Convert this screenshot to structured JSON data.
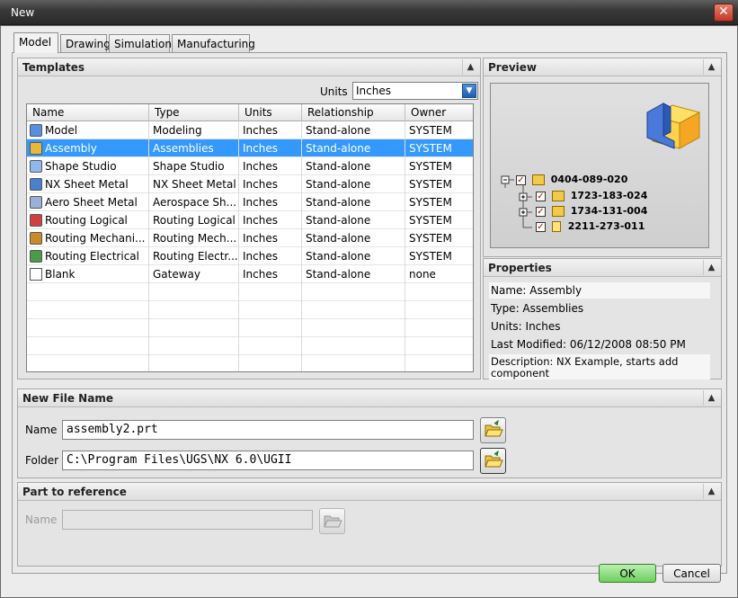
{
  "window": {
    "title": "New",
    "close_glyph": "✕"
  },
  "tabs": [
    {
      "label": "Model",
      "active": true
    },
    {
      "label": "Drawing",
      "active": false
    },
    {
      "label": "Simulation",
      "active": false
    },
    {
      "label": "Manufacturing",
      "active": false
    }
  ],
  "templates": {
    "header": "Templates",
    "units_label": "Units",
    "units_value": "Inches",
    "columns": [
      "Name",
      "Type",
      "Units",
      "Relationship",
      "Owner"
    ],
    "rows": [
      {
        "name": "Model",
        "type": "Modeling",
        "units": "Inches",
        "relationship": "Stand-alone",
        "owner": "SYSTEM",
        "icon": "model-icon"
      },
      {
        "name": "Assembly",
        "type": "Assemblies",
        "units": "Inches",
        "relationship": "Stand-alone",
        "owner": "SYSTEM",
        "icon": "assembly-icon",
        "selected": true
      },
      {
        "name": "Shape Studio",
        "type": "Shape Studio",
        "units": "Inches",
        "relationship": "Stand-alone",
        "owner": "SYSTEM",
        "icon": "shape-studio-icon"
      },
      {
        "name": "NX Sheet Metal",
        "type": "NX Sheet Metal",
        "units": "Inches",
        "relationship": "Stand-alone",
        "owner": "SYSTEM",
        "icon": "sheet-metal-icon"
      },
      {
        "name": "Aero Sheet Metal",
        "type": "Aerospace Sh...",
        "units": "Inches",
        "relationship": "Stand-alone",
        "owner": "SYSTEM",
        "icon": "aero-sheet-metal-icon"
      },
      {
        "name": "Routing Logical",
        "type": "Routing Logical",
        "units": "Inches",
        "relationship": "Stand-alone",
        "owner": "SYSTEM",
        "icon": "routing-logical-icon"
      },
      {
        "name": "Routing Mechani...",
        "type": "Routing Mech...",
        "units": "Inches",
        "relationship": "Stand-alone",
        "owner": "SYSTEM",
        "icon": "routing-mechanical-icon"
      },
      {
        "name": "Routing Electrical",
        "type": "Routing Electr...",
        "units": "Inches",
        "relationship": "Stand-alone",
        "owner": "SYSTEM",
        "icon": "routing-electrical-icon"
      },
      {
        "name": "Blank",
        "type": "Gateway",
        "units": "Inches",
        "relationship": "Stand-alone",
        "owner": "none",
        "icon": "blank-file-icon"
      }
    ]
  },
  "preview": {
    "header": "Preview",
    "tree": [
      {
        "label": "0404-089-020"
      },
      {
        "label": "1723-183-024"
      },
      {
        "label": "1734-131-004"
      },
      {
        "label": "2211-273-011"
      }
    ]
  },
  "properties": {
    "header": "Properties",
    "name": "Name: Assembly",
    "type": "Type: Assemblies",
    "units": "Units: Inches",
    "last_modified": "Last Modified: 06/12/2008 08:50 PM",
    "description": "Description: NX Example, starts add component"
  },
  "new_file_name": {
    "header": "New File Name",
    "name_label": "Name",
    "name_value": "assembly2.prt",
    "folder_label": "Folder",
    "folder_value": "C:\\Program Files\\UGS\\NX 6.0\\UGII"
  },
  "part_to_reference": {
    "header": "Part to reference",
    "name_label": "Name",
    "name_value": ""
  },
  "buttons": {
    "ok": "OK",
    "cancel": "Cancel"
  },
  "colors": {
    "selection": "#3399ff",
    "ok_button": "#6fcf5f",
    "close_button": "#c0392b"
  }
}
